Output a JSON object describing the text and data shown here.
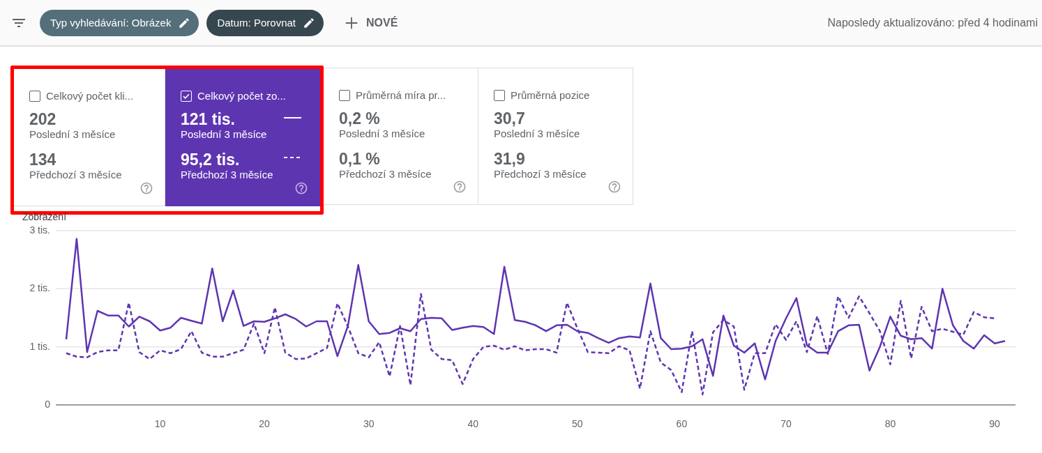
{
  "toolbar": {
    "filter_chips": [
      {
        "label": "Typ vyhledávání: Obrázek",
        "kind": "light"
      },
      {
        "label": "Datum: Porovnat",
        "kind": "dark"
      }
    ],
    "new_button": {
      "label": "NOVÉ"
    },
    "last_updated": "Naposledy aktualizováno: před 4 hodinami"
  },
  "metrics": [
    {
      "title": "Celkový počet kli...",
      "checked": false,
      "highlighted": true,
      "current_value": "202",
      "current_label": "Poslední 3 měsíce",
      "previous_value": "134",
      "previous_label": "Předchozí 3 měsíce"
    },
    {
      "title": "Celkový počet zo...",
      "checked": true,
      "highlighted": true,
      "current_value": "121 tis.",
      "current_label": "Poslední 3 měsíce",
      "previous_value": "95,2 tis.",
      "previous_label": "Předchozí 3 měsíce"
    },
    {
      "title": "Průměrná míra pr...",
      "checked": false,
      "highlighted": false,
      "current_value": "0,2 %",
      "current_label": "Poslední 3 měsíce",
      "previous_value": "0,1 %",
      "previous_label": "Předchozí 3 měsíce"
    },
    {
      "title": "Průměrná pozice",
      "checked": false,
      "highlighted": false,
      "current_value": "30,7",
      "current_label": "Poslední 3 měsíce",
      "previous_value": "31,9",
      "previous_label": "Předchozí 3 měsíce"
    }
  ],
  "chart": {
    "chart_data": {
      "type": "line",
      "ylabel": "Zobrazení",
      "x": [
        1,
        2,
        3,
        4,
        5,
        6,
        7,
        8,
        9,
        10,
        11,
        12,
        13,
        14,
        15,
        16,
        17,
        18,
        19,
        20,
        21,
        22,
        23,
        24,
        25,
        26,
        27,
        28,
        29,
        30,
        31,
        32,
        33,
        34,
        35,
        36,
        37,
        38,
        39,
        40,
        41,
        42,
        43,
        44,
        45,
        46,
        47,
        48,
        49,
        50,
        51,
        52,
        53,
        54,
        55,
        56,
        57,
        58,
        59,
        60,
        61,
        62,
        63,
        64,
        65,
        66,
        67,
        68,
        69,
        70,
        71,
        72,
        73,
        74,
        75,
        76,
        77,
        78,
        79,
        80,
        81,
        82,
        83,
        84,
        85,
        86,
        87,
        88,
        89,
        90,
        91
      ],
      "series": [
        {
          "color": "#5e35b1",
          "line_style": "solid",
          "values": [
            1.13,
            2.86,
            0.91,
            1.62,
            1.54,
            1.54,
            1.35,
            1.52,
            1.44,
            1.28,
            1.33,
            1.5,
            1.45,
            1.4,
            2.35,
            1.44,
            1.97,
            1.36,
            1.44,
            1.43,
            1.49,
            1.56,
            1.48,
            1.35,
            1.44,
            1.44,
            0.84,
            1.36,
            2.41,
            1.44,
            1.22,
            1.24,
            1.32,
            1.27,
            1.48,
            1.5,
            1.49,
            1.29,
            1.33,
            1.36,
            1.34,
            1.22,
            2.38,
            1.46,
            1.43,
            1.37,
            1.27,
            1.37,
            1.38,
            1.27,
            1.24,
            1.15,
            1.07,
            1.15,
            1.18,
            1.16,
            2.09,
            1.15,
            0.96,
            0.97,
            1.01,
            1.13,
            0.5,
            1.54,
            1.02,
            0.9,
            1.06,
            0.44,
            1.1,
            1.49,
            1.84,
            1.03,
            0.9,
            0.9,
            1.27,
            1.37,
            1.38,
            0.59,
            1.0,
            1.52,
            1.19,
            1.13,
            1.15,
            0.97,
            2.0,
            1.37,
            1.1,
            0.97,
            1.2,
            1.06,
            1.1
          ]
        },
        {
          "color": "#5e35b1",
          "line_style": "dashed",
          "values": [
            0.89,
            0.83,
            0.82,
            0.91,
            0.94,
            0.94,
            1.76,
            0.91,
            0.79,
            0.94,
            0.89,
            0.96,
            1.27,
            0.9,
            0.83,
            0.83,
            0.89,
            0.95,
            1.4,
            0.89,
            1.68,
            0.9,
            0.79,
            0.8,
            0.89,
            0.98,
            1.75,
            1.35,
            0.89,
            0.82,
            1.08,
            0.49,
            1.36,
            0.34,
            1.91,
            0.95,
            0.79,
            0.77,
            0.36,
            0.79,
            1.0,
            1.02,
            0.95,
            1.01,
            0.94,
            0.96,
            0.96,
            0.9,
            1.76,
            1.32,
            0.91,
            0.9,
            0.89,
            1.01,
            0.94,
            0.28,
            1.27,
            0.73,
            0.6,
            0.22,
            1.27,
            0.18,
            1.25,
            1.46,
            1.35,
            0.26,
            0.89,
            0.89,
            1.39,
            1.12,
            1.44,
            0.91,
            1.53,
            0.88,
            1.87,
            1.5,
            1.87,
            1.58,
            1.27,
            0.7,
            1.79,
            0.8,
            1.69,
            1.27,
            1.31,
            1.26,
            1.21,
            1.6,
            1.51,
            1.49,
            null
          ]
        }
      ],
      "ylim": [
        0,
        3
      ],
      "xlim": [
        0,
        92
      ],
      "yticks": [
        {
          "value": 0,
          "label": "0"
        },
        {
          "value": 1,
          "label": "1 tis."
        },
        {
          "value": 2,
          "label": "2 tis."
        },
        {
          "value": 3,
          "label": "3 tis."
        }
      ],
      "xticks": [
        10,
        20,
        30,
        40,
        50,
        60,
        70,
        80,
        90
      ]
    }
  }
}
